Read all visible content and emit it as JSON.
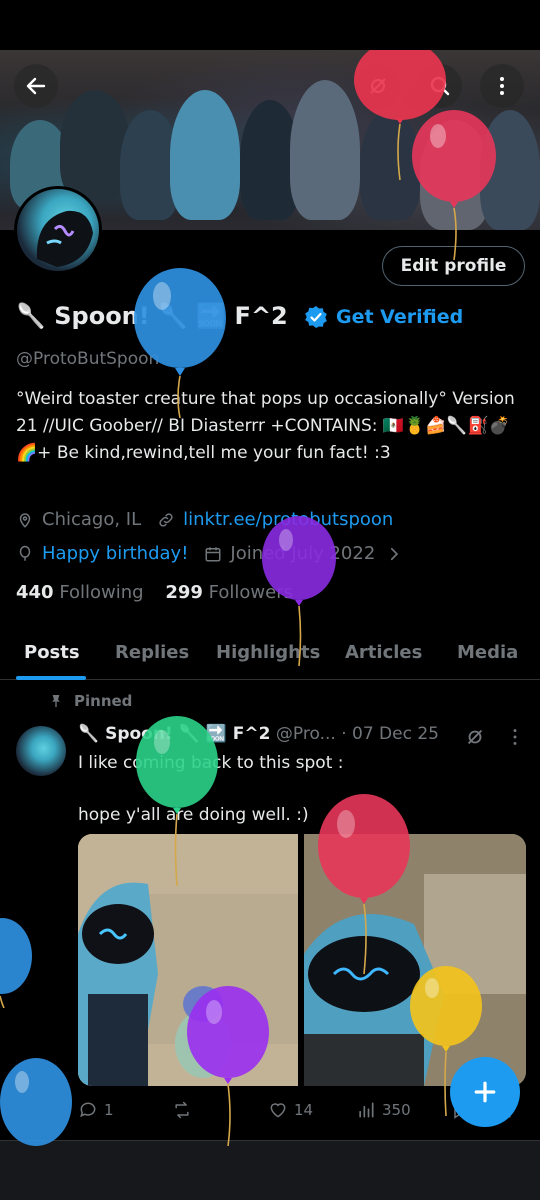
{
  "profile": {
    "display_name": "🥄 Spoon! 🥄 🔜 F^2",
    "get_verified_label": "Get Verified",
    "handle": "@ProtoButSpoon",
    "bio": "°Weird toaster creature that pops up occasionally° Version 21 //UIC Goober// BI Diasterrr +CONTAINS: 🇲🇽🍍🍰🥄⛽💣🌈+ Be kind,rewind,tell me your fun fact! :3",
    "location": "Chicago, IL",
    "website": "linktr.ee/protobutspoon",
    "birthday": "Happy birthday!",
    "joined": "Joined July 2022",
    "following_count": "440",
    "following_label": "Following",
    "followers_count": "299",
    "followers_label": "Followers"
  },
  "header": {
    "edit_profile_label": "Edit profile"
  },
  "tabs": [
    {
      "label": "Posts"
    },
    {
      "label": "Replies"
    },
    {
      "label": "Highlights"
    },
    {
      "label": "Articles"
    },
    {
      "label": "Media"
    }
  ],
  "post": {
    "pinned_label": "Pinned",
    "author_name": "🥄 Spoon! 🥄 🔜 F^2",
    "author_handle": "@Pro...",
    "date": "· 07 Dec 25",
    "text": "I like coming back to this spot :\n\nhope y'all are doing well. :)",
    "replies": "1",
    "likes": "14",
    "views": "350"
  },
  "colors": {
    "accent": "#1d9bf0",
    "background": "#000000",
    "muted": "#71767b"
  },
  "icons": [
    "back-arrow-icon",
    "search-icon",
    "more-vertical-icon",
    "verified-badge-icon",
    "location-icon",
    "link-icon",
    "balloon-icon",
    "calendar-icon",
    "chevron-right-icon",
    "pin-icon",
    "grok-icon",
    "more-horizontal-icon",
    "reply-icon",
    "retweet-icon",
    "like-icon",
    "views-icon",
    "bookmark-icon",
    "share-icon",
    "compose-plus-icon"
  ]
}
